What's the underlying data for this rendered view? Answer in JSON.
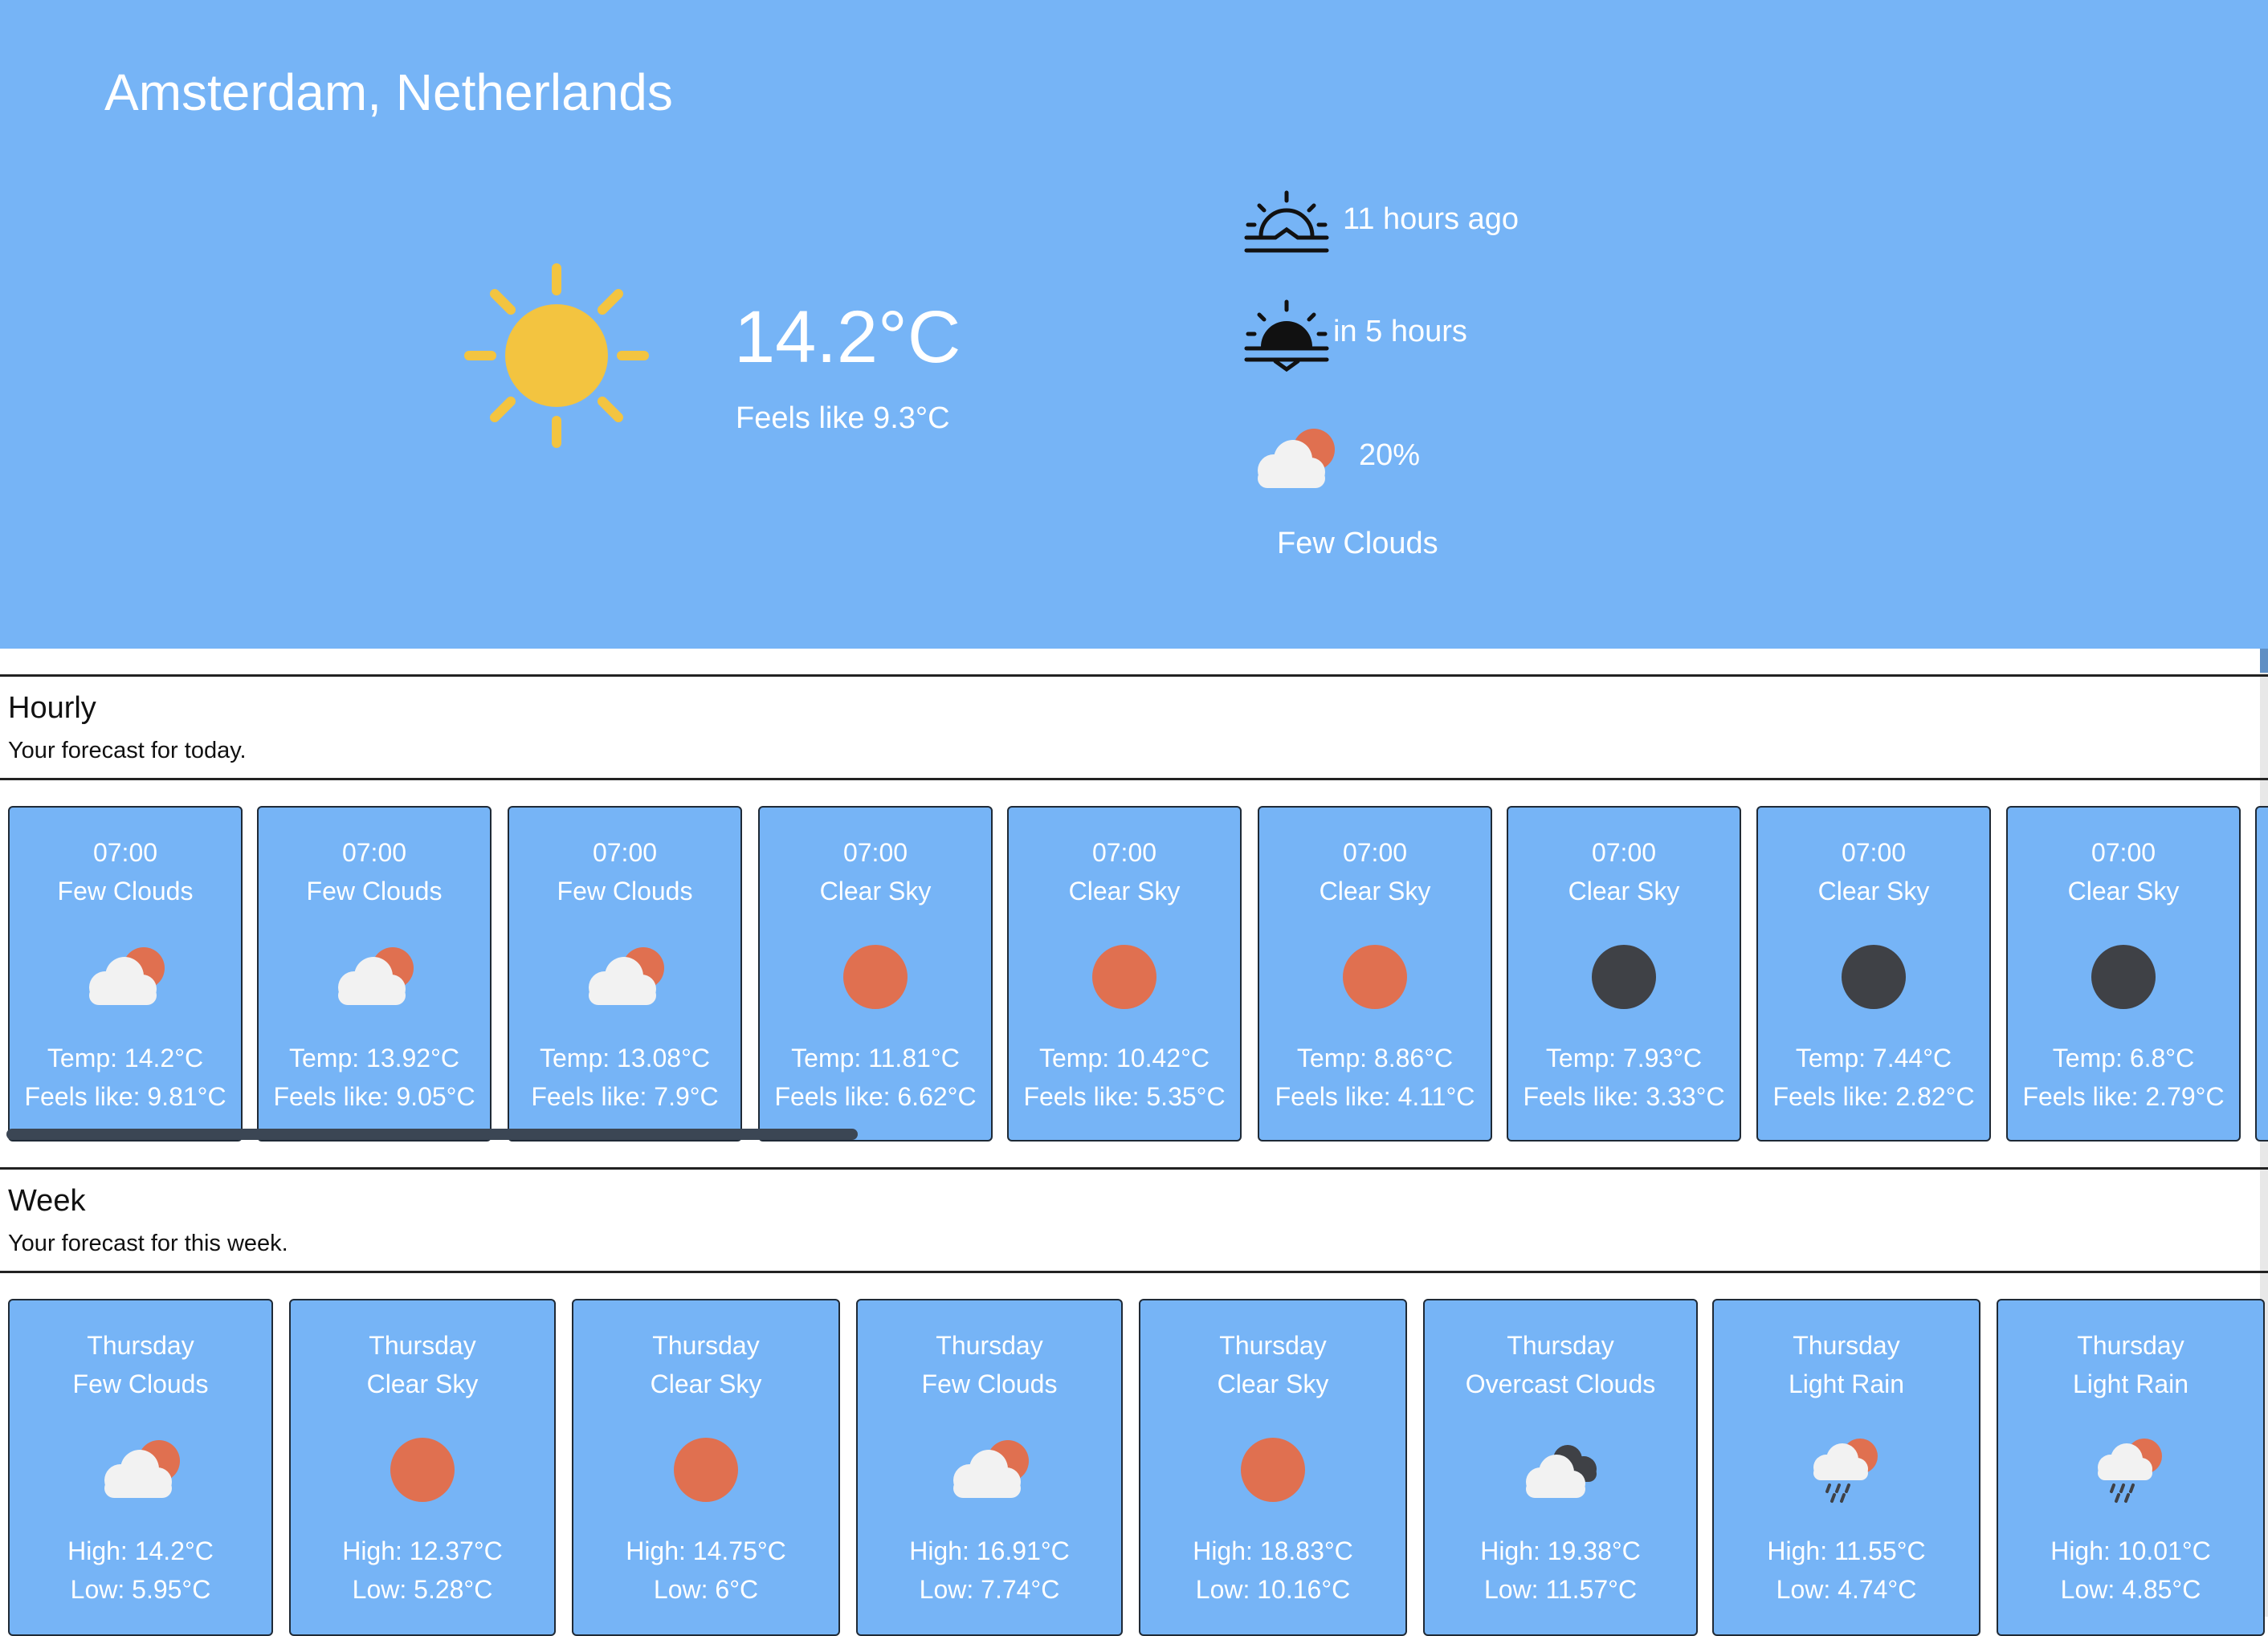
{
  "location": "Amsterdam, Netherlands",
  "current": {
    "temperature": "14.2°C",
    "feels_like": "Feels like 9.3°C",
    "sunrise_text": "11 hours ago",
    "sunset_text": "in 5 hours",
    "cloud_percent": "20%",
    "description": "Few Clouds",
    "icon": "sun-icon"
  },
  "hourly": {
    "title": "Hourly",
    "subtitle": "Your forecast for today.",
    "items": [
      {
        "time": "07:00",
        "desc": "Few Clouds",
        "icon": "few-clouds-day-icon",
        "temp": "Temp: 14.2°C",
        "feels": "Feels like: 9.81°C"
      },
      {
        "time": "07:00",
        "desc": "Few Clouds",
        "icon": "few-clouds-day-icon",
        "temp": "Temp: 13.92°C",
        "feels": "Feels like: 9.05°C"
      },
      {
        "time": "07:00",
        "desc": "Few Clouds",
        "icon": "few-clouds-day-icon",
        "temp": "Temp: 13.08°C",
        "feels": "Feels like: 7.9°C"
      },
      {
        "time": "07:00",
        "desc": "Clear Sky",
        "icon": "clear-day-icon",
        "temp": "Temp: 11.81°C",
        "feels": "Feels like: 6.62°C"
      },
      {
        "time": "07:00",
        "desc": "Clear Sky",
        "icon": "clear-day-icon",
        "temp": "Temp: 10.42°C",
        "feels": "Feels like: 5.35°C"
      },
      {
        "time": "07:00",
        "desc": "Clear Sky",
        "icon": "clear-day-icon",
        "temp": "Temp: 8.86°C",
        "feels": "Feels like: 4.11°C"
      },
      {
        "time": "07:00",
        "desc": "Clear Sky",
        "icon": "clear-night-icon",
        "temp": "Temp: 7.93°C",
        "feels": "Feels like: 3.33°C"
      },
      {
        "time": "07:00",
        "desc": "Clear Sky",
        "icon": "clear-night-icon",
        "temp": "Temp: 7.44°C",
        "feels": "Feels like: 2.82°C"
      },
      {
        "time": "07:00",
        "desc": "Clear Sky",
        "icon": "clear-night-icon",
        "temp": "Temp: 6.8°C",
        "feels": "Feels like: 2.79°C"
      }
    ]
  },
  "week": {
    "title": "Week",
    "subtitle": "Your forecast for this week.",
    "items": [
      {
        "day": "Thursday",
        "desc": "Few Clouds",
        "icon": "few-clouds-day-icon",
        "high": "High: 14.2°C",
        "low": "Low: 5.95°C"
      },
      {
        "day": "Thursday",
        "desc": "Clear Sky",
        "icon": "clear-day-icon",
        "high": "High: 12.37°C",
        "low": "Low: 5.28°C"
      },
      {
        "day": "Thursday",
        "desc": "Clear Sky",
        "icon": "clear-day-icon",
        "high": "High: 14.75°C",
        "low": "Low: 6°C"
      },
      {
        "day": "Thursday",
        "desc": "Few Clouds",
        "icon": "few-clouds-day-icon",
        "high": "High: 16.91°C",
        "low": "Low: 7.74°C"
      },
      {
        "day": "Thursday",
        "desc": "Clear Sky",
        "icon": "clear-day-icon",
        "high": "High: 18.83°C",
        "low": "Low: 10.16°C"
      },
      {
        "day": "Thursday",
        "desc": "Overcast Clouds",
        "icon": "overcast-clouds-icon",
        "high": "High: 19.38°C",
        "low": "Low: 11.57°C"
      },
      {
        "day": "Thursday",
        "desc": "Light Rain",
        "icon": "light-rain-icon",
        "high": "High: 11.55°C",
        "low": "Low: 4.74°C"
      },
      {
        "day": "Thursday",
        "desc": "Light Rain",
        "icon": "light-rain-icon",
        "high": "High: 10.01°C",
        "low": "Low: 4.85°C"
      }
    ]
  },
  "colors": {
    "hero_bg": "#76b4f6",
    "sun_yellow": "#f3c440",
    "sun_orange": "#e07050",
    "night_dark": "#3f4146"
  }
}
